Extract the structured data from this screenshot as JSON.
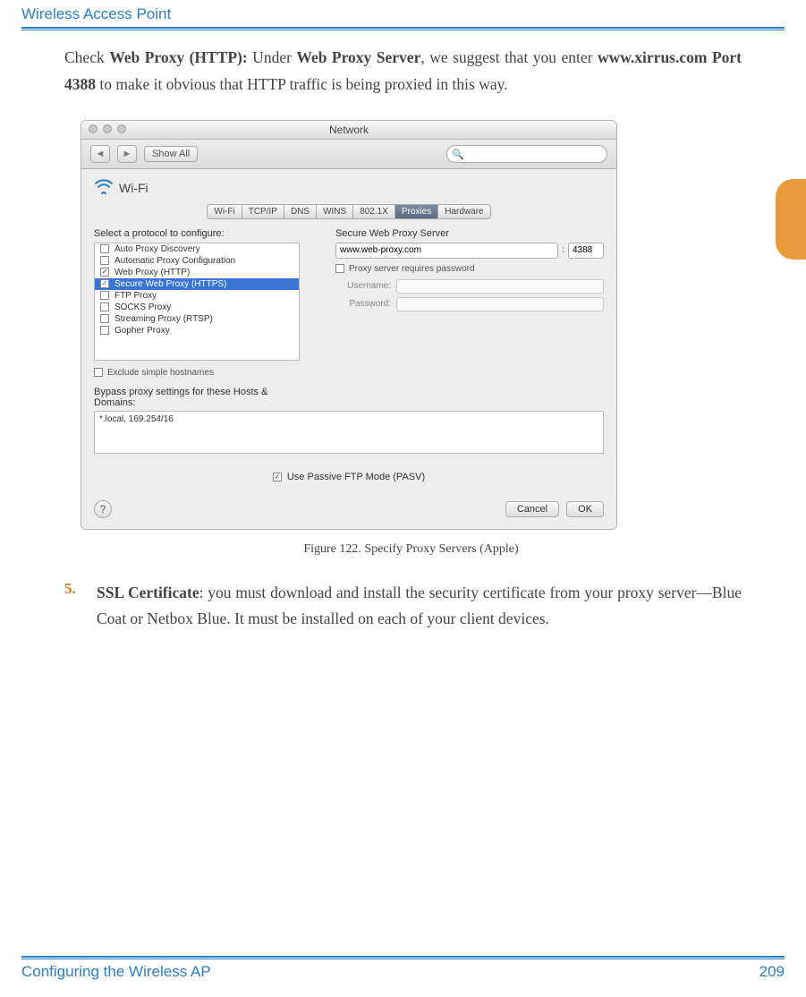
{
  "header_title": "Wireless Access Point",
  "intro": {
    "pre": "Check ",
    "bold1": "Web Proxy (HTTP):",
    "mid1": " Under ",
    "bold2": "Web Proxy Server",
    "mid2": ", we suggest that you enter ",
    "bold3": "www.xirrus.com Port 4388",
    "post": " to make it obvious that HTTP traffic is being proxied in this way."
  },
  "mac": {
    "title": "Network",
    "showall": "Show All",
    "wifi_label": "Wi-Fi",
    "tabs": [
      "Wi-Fi",
      "TCP/IP",
      "DNS",
      "WINS",
      "802.1X",
      "Proxies",
      "Hardware"
    ],
    "active_tab_index": 5,
    "select_protocol": "Select a protocol to configure:",
    "protocols": [
      {
        "label": "Auto Proxy Discovery",
        "checked": false,
        "selected": false
      },
      {
        "label": "Automatic Proxy Configuration",
        "checked": false,
        "selected": false
      },
      {
        "label": "Web Proxy (HTTP)",
        "checked": true,
        "selected": false
      },
      {
        "label": "Secure Web Proxy (HTTPS)",
        "checked": true,
        "selected": true
      },
      {
        "label": "FTP Proxy",
        "checked": false,
        "selected": false
      },
      {
        "label": "SOCKS Proxy",
        "checked": false,
        "selected": false
      },
      {
        "label": "Streaming Proxy (RTSP)",
        "checked": false,
        "selected": false
      },
      {
        "label": "Gopher Proxy",
        "checked": false,
        "selected": false
      }
    ],
    "server_header": "Secure Web Proxy Server",
    "server_value": "www.web-proxy.com",
    "port_value": "4388",
    "requires_password": "Proxy server requires password",
    "username_label": "Username:",
    "password_label": "Password:",
    "exclude_simple": "Exclude simple hostnames",
    "bypass_label": "Bypass proxy settings for these Hosts & Domains:",
    "bypass_value": "*.local, 169.254/16",
    "passive_ftp": "Use Passive FTP Mode (PASV)",
    "cancel": "Cancel",
    "ok": "OK"
  },
  "figure_caption": "Figure 122. Specify Proxy Servers (Apple)",
  "step5": {
    "num": "5.",
    "boldtitle": "SSL Certificate",
    "rest": ": you must download and install the security certificate from your proxy server—Blue Coat or Netbox Blue. It must be installed on each of your client devices."
  },
  "footer_left": "Configuring the Wireless AP",
  "footer_right": "209"
}
